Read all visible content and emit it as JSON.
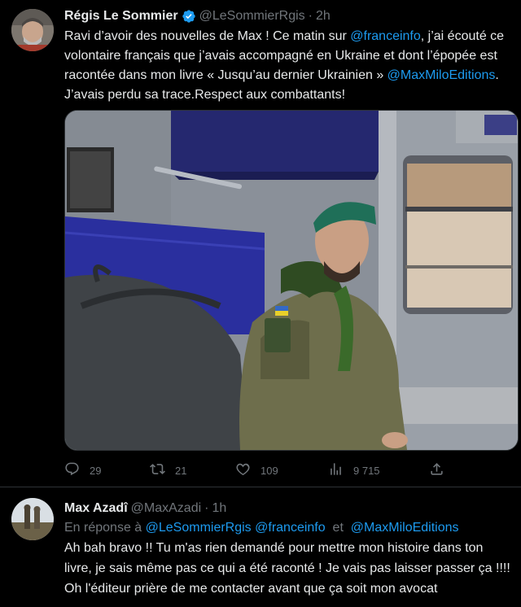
{
  "tweet1": {
    "name": "Régis Le Sommier",
    "handle": "@LeSommierRgis",
    "separator": "·",
    "time": "2h",
    "text_part1": "Ravi d’avoir des nouvelles de Max ! Ce matin sur ",
    "mention1": "@franceinfo",
    "text_part2": ", j’ai écouté ce volontaire français que j’avais accompagné en Ukraine et dont l’épopée est racontée dans mon livre « Jusqu’au dernier Ukrainien » ",
    "mention2": "@MaxMiloEditions",
    "text_part3": ". J’avais perdu sa trace.Respect aux combattants!",
    "stats": {
      "replies": "29",
      "retweets": "21",
      "likes": "109",
      "views": "9 715"
    },
    "icons": [
      "verified-icon",
      "reply-icon",
      "retweet-icon",
      "like-icon",
      "views-icon",
      "share-icon"
    ]
  },
  "tweet2": {
    "name": "Max Azadî",
    "handle": "@MaxAzadi",
    "separator": "·",
    "time": "1h",
    "reply_prefix": "En réponse à ",
    "reply_mention1": "@LeSommierRgis",
    "reply_mention2": "@franceinfo",
    "reply_and": "et",
    "reply_mention3": "@MaxMiloEditions",
    "text": "Ah bah bravo !! Tu m'as rien demandé pour mettre mon histoire dans ton livre, je sais même pas ce qui a été raconté ! Je vais pas laisser passer ça !!!! Oh l'éditeur prière de me contacter avant que ça soit mon avocat"
  },
  "colors": {
    "background": "#000000",
    "text": "#e7e9ea",
    "muted": "#71767b",
    "link": "#1d9bf0",
    "divider": "#2f3336"
  }
}
